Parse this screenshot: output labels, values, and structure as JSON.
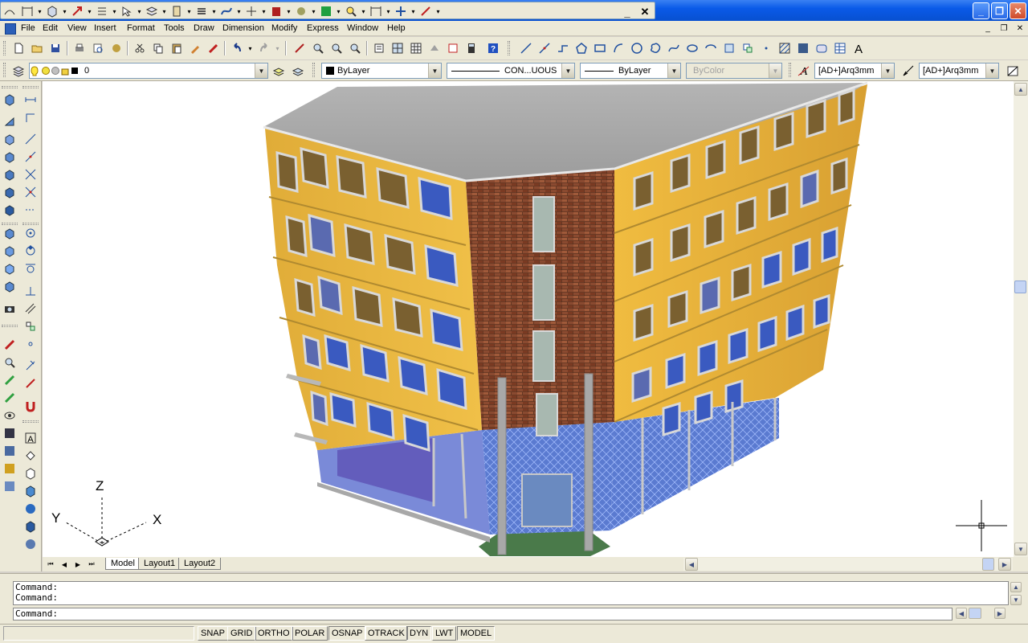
{
  "titlebar": {
    "float_tool_count": 16,
    "close_symbol": "✕",
    "min_symbol": "_",
    "window_buttons": [
      "_",
      "❐",
      "✕"
    ]
  },
  "menu": {
    "items": [
      "File",
      "Edit",
      "View",
      "Insert",
      "Format",
      "Tools",
      "Draw",
      "Dimension",
      "Modify",
      "Express",
      "Window",
      "Help"
    ],
    "mdi_buttons": [
      "_",
      "❐",
      "✕"
    ]
  },
  "properties": {
    "layer": "0",
    "color": "ByLayer",
    "linetype": "CON...UOUS",
    "lineweight": "ByLayer",
    "plotstyle": "ByColor",
    "text_style": "[AD+]Arq3mm",
    "dim_style": "[AD+]Arq3mm"
  },
  "ucs": {
    "x": "X",
    "y": "Y",
    "z": "Z"
  },
  "tabs": [
    "Model",
    "Layout1",
    "Layout2"
  ],
  "command": {
    "history": [
      "Command:",
      "Command:"
    ],
    "prompt": "Command:"
  },
  "status": [
    "SNAP",
    "GRID",
    "ORTHO",
    "POLAR",
    "OSNAP",
    "OTRACK",
    "DYN",
    "LWT",
    "MODEL"
  ],
  "colors": {
    "title_blue": "#0a5ae8",
    "chrome": "#ece9d8",
    "facade_yellow": "#e8b840",
    "brick": "#8c4a32",
    "roof": "#a8a8a8",
    "glass": "#6a8ad0"
  }
}
